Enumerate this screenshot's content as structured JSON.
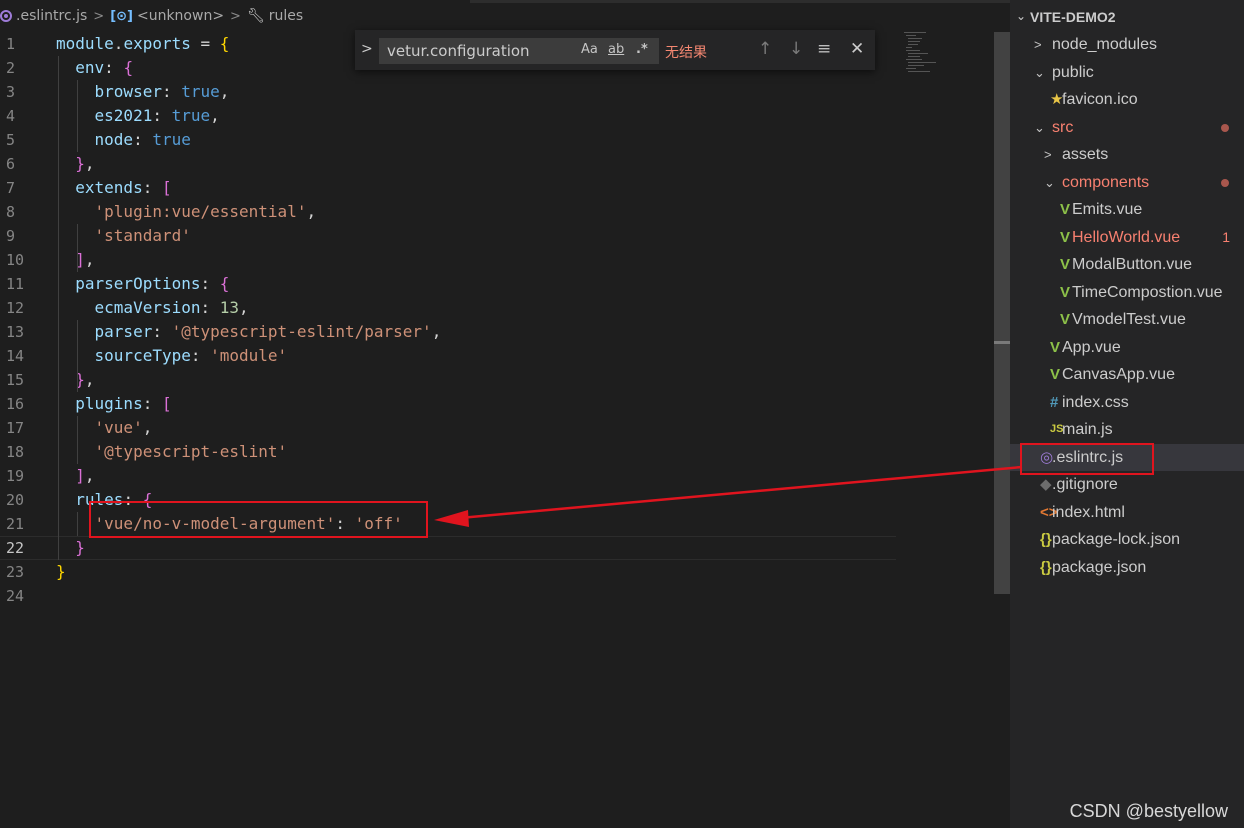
{
  "breadcrumb": {
    "file": ".eslintrc.js",
    "symbol": "<unknown>",
    "property": "rules",
    "separator": ">"
  },
  "find": {
    "toggle": ">",
    "value": "vetur.configuration",
    "match_case": "Aa",
    "whole_word": "ab",
    "regex": ".*",
    "result": "无结果",
    "prev_icon": "↑",
    "next_icon": "↓",
    "selection_icon": "≡",
    "close_icon": "✕"
  },
  "editor": {
    "active_line": 22,
    "lines": [
      {
        "n": "1",
        "t": [
          [
            "t-var",
            "module"
          ],
          [
            "t-def",
            "."
          ],
          [
            "t-var",
            "exports"
          ],
          [
            "t-def",
            " = "
          ],
          [
            "b1",
            "{"
          ]
        ]
      },
      {
        "n": "2",
        "t": [
          [
            "t-def",
            "  "
          ],
          [
            "t-var",
            "env"
          ],
          [
            "t-def",
            ": "
          ],
          [
            "b2",
            "{"
          ]
        ]
      },
      {
        "n": "3",
        "t": [
          [
            "t-def",
            "    "
          ],
          [
            "t-var",
            "browser"
          ],
          [
            "t-def",
            ": "
          ],
          [
            "t-lit",
            "true"
          ],
          [
            "t-def",
            ","
          ]
        ]
      },
      {
        "n": "4",
        "t": [
          [
            "t-def",
            "    "
          ],
          [
            "t-var",
            "es2021"
          ],
          [
            "t-def",
            ": "
          ],
          [
            "t-lit",
            "true"
          ],
          [
            "t-def",
            ","
          ]
        ]
      },
      {
        "n": "5",
        "t": [
          [
            "t-def",
            "    "
          ],
          [
            "t-var",
            "node"
          ],
          [
            "t-def",
            ": "
          ],
          [
            "t-lit",
            "true"
          ]
        ]
      },
      {
        "n": "6",
        "t": [
          [
            "t-def",
            "  "
          ],
          [
            "b2",
            "}"
          ],
          [
            "t-def",
            ","
          ]
        ]
      },
      {
        "n": "7",
        "t": [
          [
            "t-def",
            "  "
          ],
          [
            "t-var",
            "extends"
          ],
          [
            "t-def",
            ": "
          ],
          [
            "b2",
            "["
          ]
        ]
      },
      {
        "n": "8",
        "t": [
          [
            "t-def",
            "    "
          ],
          [
            "t-str",
            "'plugin:vue/essential'"
          ],
          [
            "t-def",
            ","
          ]
        ]
      },
      {
        "n": "9",
        "t": [
          [
            "t-def",
            "    "
          ],
          [
            "t-str",
            "'standard'"
          ]
        ]
      },
      {
        "n": "10",
        "t": [
          [
            "t-def",
            "  "
          ],
          [
            "b2",
            "]"
          ],
          [
            "t-def",
            ","
          ]
        ]
      },
      {
        "n": "11",
        "t": [
          [
            "t-def",
            "  "
          ],
          [
            "t-var",
            "parserOptions"
          ],
          [
            "t-def",
            ": "
          ],
          [
            "b2",
            "{"
          ]
        ]
      },
      {
        "n": "12",
        "t": [
          [
            "t-def",
            "    "
          ],
          [
            "t-var",
            "ecmaVersion"
          ],
          [
            "t-def",
            ": "
          ],
          [
            "t-num",
            "13"
          ],
          [
            "t-def",
            ","
          ]
        ]
      },
      {
        "n": "13",
        "t": [
          [
            "t-def",
            "    "
          ],
          [
            "t-var",
            "parser"
          ],
          [
            "t-def",
            ": "
          ],
          [
            "t-str",
            "'@typescript-eslint/parser'"
          ],
          [
            "t-def",
            ","
          ]
        ]
      },
      {
        "n": "14",
        "t": [
          [
            "t-def",
            "    "
          ],
          [
            "t-var",
            "sourceType"
          ],
          [
            "t-def",
            ": "
          ],
          [
            "t-str",
            "'module'"
          ]
        ]
      },
      {
        "n": "15",
        "t": [
          [
            "t-def",
            "  "
          ],
          [
            "b2",
            "}"
          ],
          [
            "t-def",
            ","
          ]
        ]
      },
      {
        "n": "16",
        "t": [
          [
            "t-def",
            "  "
          ],
          [
            "t-var",
            "plugins"
          ],
          [
            "t-def",
            ": "
          ],
          [
            "b2",
            "["
          ]
        ]
      },
      {
        "n": "17",
        "t": [
          [
            "t-def",
            "    "
          ],
          [
            "t-str",
            "'vue'"
          ],
          [
            "t-def",
            ","
          ]
        ]
      },
      {
        "n": "18",
        "t": [
          [
            "t-def",
            "    "
          ],
          [
            "t-str",
            "'@typescript-eslint'"
          ]
        ]
      },
      {
        "n": "19",
        "t": [
          [
            "t-def",
            "  "
          ],
          [
            "b2",
            "]"
          ],
          [
            "t-def",
            ","
          ]
        ]
      },
      {
        "n": "20",
        "t": [
          [
            "t-def",
            "  "
          ],
          [
            "t-var",
            "rules"
          ],
          [
            "t-def",
            ": "
          ],
          [
            "b2",
            "{"
          ]
        ]
      },
      {
        "n": "21",
        "t": [
          [
            "t-def",
            "    "
          ],
          [
            "t-str",
            "'vue/no-v-model-argument'"
          ],
          [
            "t-def",
            ": "
          ],
          [
            "t-str",
            "'off'"
          ]
        ]
      },
      {
        "n": "22",
        "t": [
          [
            "t-def",
            "  "
          ],
          [
            "b2",
            "}"
          ]
        ]
      },
      {
        "n": "23",
        "t": [
          [
            "b1",
            "}"
          ]
        ]
      },
      {
        "n": "24",
        "t": []
      }
    ]
  },
  "explorer": {
    "title": "VITE-DEMO2",
    "items": [
      {
        "label": "node_modules",
        "chev": ">",
        "icon": "",
        "icon_name": "chevron-right-icon",
        "status": "",
        "indent": 1
      },
      {
        "label": "public",
        "chev": "⌄",
        "icon": "",
        "icon_name": "chevron-down-icon",
        "status": "",
        "indent": 1
      },
      {
        "label": "favicon.ico",
        "chev": "",
        "icon": "★",
        "icon_name": "star-icon",
        "icon_class": "star-ico",
        "status": "",
        "indent": 2
      },
      {
        "label": "src",
        "chev": "⌄",
        "icon": "",
        "icon_name": "chevron-down-icon",
        "status": "dot",
        "modified": true,
        "indent": 1
      },
      {
        "label": "assets",
        "chev": ">",
        "icon": "",
        "icon_name": "chevron-right-icon",
        "status": "",
        "indent": 2
      },
      {
        "label": "components",
        "chev": "⌄",
        "icon": "",
        "icon_name": "chevron-down-icon",
        "status": "dot",
        "modified": true,
        "indent": 2
      },
      {
        "label": "Emits.vue",
        "chev": "",
        "icon": "V",
        "icon_name": "vue-icon",
        "icon_class": "vue-ico",
        "status": "",
        "indent": 3
      },
      {
        "label": "HelloWorld.vue",
        "chev": "",
        "icon": "V",
        "icon_name": "vue-icon",
        "icon_class": "vue-ico",
        "status": "1",
        "modified": true,
        "indent": 3
      },
      {
        "label": "ModalButton.vue",
        "chev": "",
        "icon": "V",
        "icon_name": "vue-icon",
        "icon_class": "vue-ico",
        "status": "",
        "indent": 3
      },
      {
        "label": "TimeCompostion.vue",
        "chev": "",
        "icon": "V",
        "icon_name": "vue-icon",
        "icon_class": "vue-ico",
        "status": "",
        "indent": 3
      },
      {
        "label": "VmodelTest.vue",
        "chev": "",
        "icon": "V",
        "icon_name": "vue-icon",
        "icon_class": "vue-ico",
        "status": "",
        "indent": 3
      },
      {
        "label": "App.vue",
        "chev": "",
        "icon": "V",
        "icon_name": "vue-icon",
        "icon_class": "vue-ico",
        "status": "",
        "indent": 2
      },
      {
        "label": "CanvasApp.vue",
        "chev": "",
        "icon": "V",
        "icon_name": "vue-icon",
        "icon_class": "vue-ico",
        "status": "",
        "indent": 2
      },
      {
        "label": "index.css",
        "chev": "",
        "icon": "#",
        "icon_name": "css-icon",
        "icon_class": "css-ico",
        "status": "",
        "indent": 2
      },
      {
        "label": "main.js",
        "chev": "",
        "icon": "JS",
        "icon_name": "js-icon",
        "icon_class": "js-ico",
        "status": "",
        "indent": 2
      },
      {
        "label": ".eslintrc.js",
        "chev": "",
        "icon": "◎",
        "icon_name": "eslint-icon",
        "icon_class": "eslint-file",
        "status": "",
        "indent": 1,
        "selected": true
      },
      {
        "label": ".gitignore",
        "chev": "",
        "icon": "◆",
        "icon_name": "git-icon",
        "icon_class": "git-ico",
        "status": "",
        "indent": 1
      },
      {
        "label": "index.html",
        "chev": "",
        "icon": "<>",
        "icon_name": "html-icon",
        "icon_class": "html-ico",
        "status": "",
        "indent": 1
      },
      {
        "label": "package-lock.json",
        "chev": "",
        "icon": "{}",
        "icon_name": "json-icon",
        "icon_class": "json-ico",
        "status": "",
        "indent": 1
      },
      {
        "label": "package.json",
        "chev": "",
        "icon": "{}",
        "icon_name": "json-icon",
        "icon_class": "json-ico",
        "status": "",
        "indent": 1
      }
    ]
  },
  "watermark": "CSDN @bestyellow",
  "colors": {
    "annotation": "#e0141e",
    "modified": "#f88070",
    "vue": "#8dc149"
  }
}
